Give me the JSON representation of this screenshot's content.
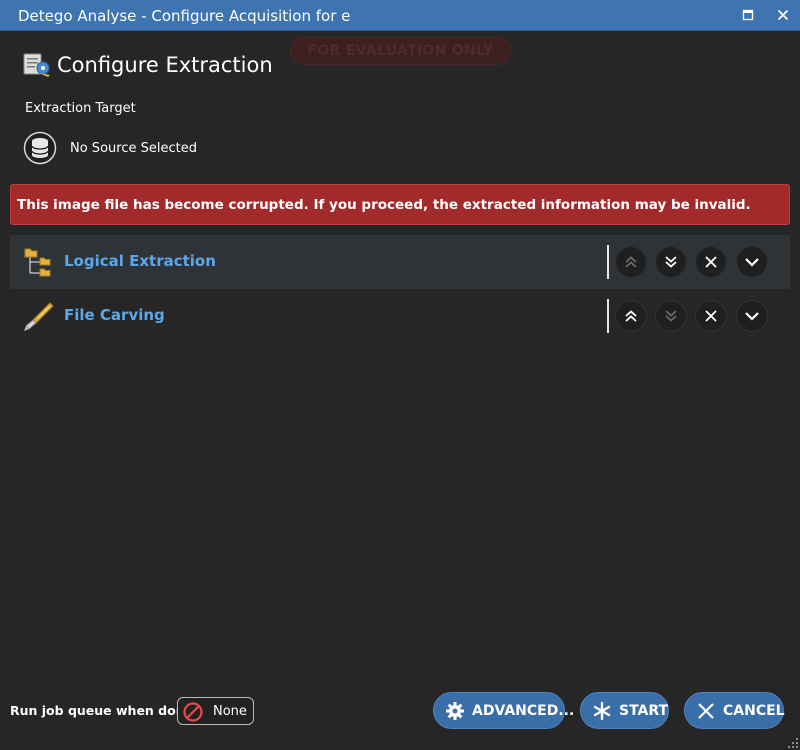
{
  "window": {
    "title": "Detego Analyse - Configure Acquisition for e"
  },
  "watermark": "FOR EVALUATION ONLY",
  "page": {
    "title": "Configure Extraction",
    "icon": "configure-icon"
  },
  "target": {
    "label": "Extraction Target",
    "source": "No Source Selected",
    "icon": "database-icon"
  },
  "error": {
    "message": "This image file has become corrupted. If you proceed, the extracted information may be invalid."
  },
  "steps": [
    {
      "name": "Logical Extraction",
      "icon": "folder-tree-icon",
      "selected": true
    },
    {
      "name": "File Carving",
      "icon": "knife-icon",
      "selected": false
    }
  ],
  "footer": {
    "queue_label": "Run job queue when done:",
    "queue_value": "None",
    "advanced": "ADVANCED...",
    "start": "START",
    "cancel": "CANCEL"
  },
  "colors": {
    "background": "#262626",
    "titlebar": "#3e74b0",
    "error": "#a22a2a",
    "accent_text": "#5da7e8",
    "button": "#3a6ea8"
  }
}
